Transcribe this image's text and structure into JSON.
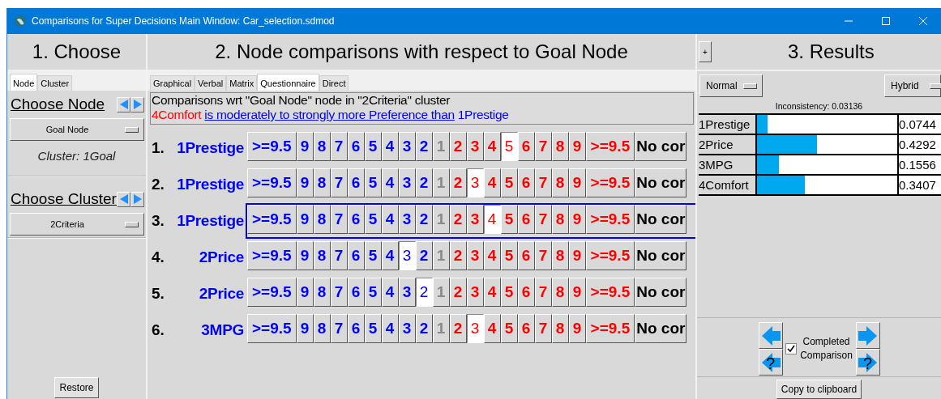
{
  "window": {
    "title": "Comparisons for Super Decisions Main Window: Car_selection.sdmod"
  },
  "choose": {
    "heading": "1. Choose",
    "tabs": [
      {
        "label": "Node",
        "selected": true
      },
      {
        "label": "Cluster",
        "selected": false
      }
    ],
    "node_label": "Choose Node",
    "node_value": "Goal Node",
    "cluster_info": "Cluster: 1Goal",
    "cluster_label": "Choose Cluster",
    "cluster_value": "2Criteria",
    "restore": "Restore"
  },
  "comparisons": {
    "heading": "2. Node comparisons with respect to Goal Node",
    "tabs": [
      {
        "label": "Graphical",
        "selected": false
      },
      {
        "label": "Verbal",
        "selected": false
      },
      {
        "label": "Matrix",
        "selected": false
      },
      {
        "label": "Questionnaire",
        "selected": true
      },
      {
        "label": "Direct",
        "selected": false
      }
    ],
    "info": "Comparisons wrt \"Goal Node\" node in \"2Criteria\" cluster",
    "verdict": {
      "node_a": "4Comfort",
      "phrase": "is moderately to strongly more Preference than",
      "node_b": "1Prestige"
    },
    "rows": [
      {
        "number": "1.",
        "node": "1Prestige",
        "current": false,
        "cells": [
          {
            "label": ">=9.5",
            "kind": "left",
            "selected": false
          },
          {
            "label": "9",
            "kind": "left",
            "selected": false
          },
          {
            "label": "8",
            "kind": "left",
            "selected": false
          },
          {
            "label": "7",
            "kind": "left",
            "selected": false
          },
          {
            "label": "6",
            "kind": "left",
            "selected": false
          },
          {
            "label": "5",
            "kind": "left",
            "selected": false
          },
          {
            "label": "4",
            "kind": "left",
            "selected": false
          },
          {
            "label": "3",
            "kind": "left",
            "selected": false
          },
          {
            "label": "2",
            "kind": "left",
            "selected": false
          },
          {
            "label": "1",
            "kind": "equal",
            "selected": false
          },
          {
            "label": "2",
            "kind": "right",
            "selected": false
          },
          {
            "label": "3",
            "kind": "right",
            "selected": false
          },
          {
            "label": "4",
            "kind": "right",
            "selected": false
          },
          {
            "label": "5",
            "kind": "right",
            "selected": true
          },
          {
            "label": "6",
            "kind": "right",
            "selected": false
          },
          {
            "label": "7",
            "kind": "right",
            "selected": false
          },
          {
            "label": "8",
            "kind": "right",
            "selected": false
          },
          {
            "label": "9",
            "kind": "right",
            "selected": false
          },
          {
            "label": ">=9.5",
            "kind": "right",
            "selected": false
          },
          {
            "label": "No cor",
            "kind": "none",
            "selected": false
          }
        ]
      },
      {
        "number": "2.",
        "node": "1Prestige",
        "current": false,
        "cells": [
          {
            "label": ">=9.5",
            "kind": "left",
            "selected": false
          },
          {
            "label": "9",
            "kind": "left",
            "selected": false
          },
          {
            "label": "8",
            "kind": "left",
            "selected": false
          },
          {
            "label": "7",
            "kind": "left",
            "selected": false
          },
          {
            "label": "6",
            "kind": "left",
            "selected": false
          },
          {
            "label": "5",
            "kind": "left",
            "selected": false
          },
          {
            "label": "4",
            "kind": "left",
            "selected": false
          },
          {
            "label": "3",
            "kind": "left",
            "selected": false
          },
          {
            "label": "2",
            "kind": "left",
            "selected": false
          },
          {
            "label": "1",
            "kind": "equal",
            "selected": false
          },
          {
            "label": "2",
            "kind": "right",
            "selected": false
          },
          {
            "label": "3",
            "kind": "right",
            "selected": true
          },
          {
            "label": "4",
            "kind": "right",
            "selected": false
          },
          {
            "label": "5",
            "kind": "right",
            "selected": false
          },
          {
            "label": "6",
            "kind": "right",
            "selected": false
          },
          {
            "label": "7",
            "kind": "right",
            "selected": false
          },
          {
            "label": "8",
            "kind": "right",
            "selected": false
          },
          {
            "label": "9",
            "kind": "right",
            "selected": false
          },
          {
            "label": ">=9.5",
            "kind": "right",
            "selected": false
          },
          {
            "label": "No cor",
            "kind": "none",
            "selected": false
          }
        ]
      },
      {
        "number": "3.",
        "node": "1Prestige",
        "current": true,
        "cells": [
          {
            "label": ">=9.5",
            "kind": "left",
            "selected": false
          },
          {
            "label": "9",
            "kind": "left",
            "selected": false
          },
          {
            "label": "8",
            "kind": "left",
            "selected": false
          },
          {
            "label": "7",
            "kind": "left",
            "selected": false
          },
          {
            "label": "6",
            "kind": "left",
            "selected": false
          },
          {
            "label": "5",
            "kind": "left",
            "selected": false
          },
          {
            "label": "4",
            "kind": "left",
            "selected": false
          },
          {
            "label": "3",
            "kind": "left",
            "selected": false
          },
          {
            "label": "2",
            "kind": "left",
            "selected": false
          },
          {
            "label": "1",
            "kind": "equal",
            "selected": false
          },
          {
            "label": "2",
            "kind": "right",
            "selected": false
          },
          {
            "label": "3",
            "kind": "right",
            "selected": false
          },
          {
            "label": "4",
            "kind": "right",
            "selected": true
          },
          {
            "label": "5",
            "kind": "right",
            "selected": false
          },
          {
            "label": "6",
            "kind": "right",
            "selected": false
          },
          {
            "label": "7",
            "kind": "right",
            "selected": false
          },
          {
            "label": "8",
            "kind": "right",
            "selected": false
          },
          {
            "label": "9",
            "kind": "right",
            "selected": false
          },
          {
            "label": ">=9.5",
            "kind": "right",
            "selected": false
          },
          {
            "label": "No cor",
            "kind": "none",
            "selected": false
          }
        ]
      },
      {
        "number": "4.",
        "node": "2Price",
        "current": false,
        "cells": [
          {
            "label": ">=9.5",
            "kind": "left",
            "selected": false
          },
          {
            "label": "9",
            "kind": "left",
            "selected": false
          },
          {
            "label": "8",
            "kind": "left",
            "selected": false
          },
          {
            "label": "7",
            "kind": "left",
            "selected": false
          },
          {
            "label": "6",
            "kind": "left",
            "selected": false
          },
          {
            "label": "5",
            "kind": "left",
            "selected": false
          },
          {
            "label": "4",
            "kind": "left",
            "selected": false
          },
          {
            "label": "3",
            "kind": "left",
            "selected": true
          },
          {
            "label": "2",
            "kind": "left",
            "selected": false
          },
          {
            "label": "1",
            "kind": "equal",
            "selected": false
          },
          {
            "label": "2",
            "kind": "right",
            "selected": false
          },
          {
            "label": "3",
            "kind": "right",
            "selected": false
          },
          {
            "label": "4",
            "kind": "right",
            "selected": false
          },
          {
            "label": "5",
            "kind": "right",
            "selected": false
          },
          {
            "label": "6",
            "kind": "right",
            "selected": false
          },
          {
            "label": "7",
            "kind": "right",
            "selected": false
          },
          {
            "label": "8",
            "kind": "right",
            "selected": false
          },
          {
            "label": "9",
            "kind": "right",
            "selected": false
          },
          {
            "label": ">=9.5",
            "kind": "right",
            "selected": false
          },
          {
            "label": "No cor",
            "kind": "none",
            "selected": false
          }
        ]
      },
      {
        "number": "5.",
        "node": "2Price",
        "current": false,
        "cells": [
          {
            "label": ">=9.5",
            "kind": "left",
            "selected": false
          },
          {
            "label": "9",
            "kind": "left",
            "selected": false
          },
          {
            "label": "8",
            "kind": "left",
            "selected": false
          },
          {
            "label": "7",
            "kind": "left",
            "selected": false
          },
          {
            "label": "6",
            "kind": "left",
            "selected": false
          },
          {
            "label": "5",
            "kind": "left",
            "selected": false
          },
          {
            "label": "4",
            "kind": "left",
            "selected": false
          },
          {
            "label": "3",
            "kind": "left",
            "selected": false
          },
          {
            "label": "2",
            "kind": "left",
            "selected": true
          },
          {
            "label": "1",
            "kind": "equal",
            "selected": false
          },
          {
            "label": "2",
            "kind": "right",
            "selected": false
          },
          {
            "label": "3",
            "kind": "right",
            "selected": false
          },
          {
            "label": "4",
            "kind": "right",
            "selected": false
          },
          {
            "label": "5",
            "kind": "right",
            "selected": false
          },
          {
            "label": "6",
            "kind": "right",
            "selected": false
          },
          {
            "label": "7",
            "kind": "right",
            "selected": false
          },
          {
            "label": "8",
            "kind": "right",
            "selected": false
          },
          {
            "label": "9",
            "kind": "right",
            "selected": false
          },
          {
            "label": ">=9.5",
            "kind": "right",
            "selected": false
          },
          {
            "label": "No cor",
            "kind": "none",
            "selected": false
          }
        ]
      },
      {
        "number": "6.",
        "node": "3MPG",
        "current": false,
        "cells": [
          {
            "label": ">=9.5",
            "kind": "left",
            "selected": false
          },
          {
            "label": "9",
            "kind": "left",
            "selected": false
          },
          {
            "label": "8",
            "kind": "left",
            "selected": false
          },
          {
            "label": "7",
            "kind": "left",
            "selected": false
          },
          {
            "label": "6",
            "kind": "left",
            "selected": false
          },
          {
            "label": "5",
            "kind": "left",
            "selected": false
          },
          {
            "label": "4",
            "kind": "left",
            "selected": false
          },
          {
            "label": "3",
            "kind": "left",
            "selected": false
          },
          {
            "label": "2",
            "kind": "left",
            "selected": false
          },
          {
            "label": "1",
            "kind": "equal",
            "selected": false
          },
          {
            "label": "2",
            "kind": "right",
            "selected": false
          },
          {
            "label": "3",
            "kind": "right",
            "selected": true
          },
          {
            "label": "4",
            "kind": "right",
            "selected": false
          },
          {
            "label": "5",
            "kind": "right",
            "selected": false
          },
          {
            "label": "6",
            "kind": "right",
            "selected": false
          },
          {
            "label": "7",
            "kind": "right",
            "selected": false
          },
          {
            "label": "8",
            "kind": "right",
            "selected": false
          },
          {
            "label": "9",
            "kind": "right",
            "selected": false
          },
          {
            "label": ">=9.5",
            "kind": "right",
            "selected": false
          },
          {
            "label": "No cor",
            "kind": "none",
            "selected": false
          }
        ]
      }
    ]
  },
  "results": {
    "expand": "+",
    "heading": "3. Results",
    "mode": "Normal",
    "method": "Hybrid",
    "inconsistency": "Inconsistency: 0.03136",
    "priorities": [
      {
        "name": "1Prestige",
        "level": 0.0744,
        "value": "0.0744"
      },
      {
        "name": "2Price",
        "level": 0.4292,
        "value": "0.4292"
      },
      {
        "name": "3MPG",
        "level": 0.1556,
        "value": "0.1556"
      },
      {
        "name": "4Comfort",
        "level": 0.3407,
        "value": "0.3407"
      }
    ],
    "help_marks": [
      "?",
      "?"
    ],
    "completed": {
      "label": "Completed Comparison",
      "checked": true
    },
    "copy": "Copy to clipboard"
  }
}
